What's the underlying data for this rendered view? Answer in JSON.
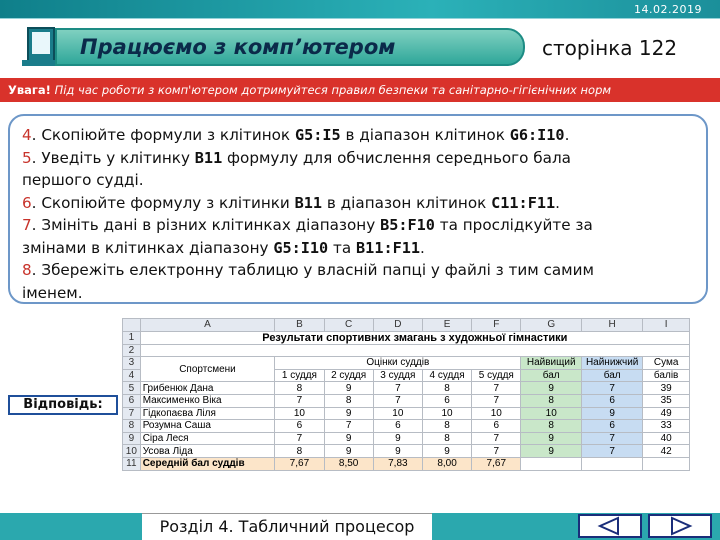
{
  "header": {
    "date": "14.02.2019",
    "title": "Працюємо з комп’ютером",
    "page": "сторінка 122"
  },
  "warning": {
    "label": "Увага!",
    "text": "Під час роботи з комп'ютером дотримуйтеся правил безпеки та санітарно-гігієнічних норм"
  },
  "task": {
    "l1": {
      "n": "4",
      "a": ". Скопіюйте формули з клітинок ",
      "b": "G5:I5",
      "c": " в діапазон клітинок ",
      "d": "G6:I10",
      "e": "."
    },
    "l2": {
      "n": "5",
      "a": ". Уведіть у клітинку ",
      "b": "B11",
      "c": " формулу для обчислення середнього бала"
    },
    "l3": "першого судді.",
    "l4": {
      "n": "6",
      "a": ". Скопіюйте формулу з клітинки ",
      "b": "B11",
      "c": " в діапазон клітинок ",
      "d": "C11:F11",
      "e": "."
    },
    "l5": {
      "n": "7",
      "a": ". Змініть дані в різних клітинках діапазону ",
      "b": "B5:F10",
      "c": " та прослідкуйте за"
    },
    "l6": {
      "a": "змінами в клітинках діапазону ",
      "b": "G5:I10",
      "c": " та ",
      "d": "B11:F11",
      "e": "."
    },
    "l7": {
      "n": "8",
      "a": ". Збережіть електронну таблицю у власній папці у файлі з тим самим"
    },
    "l8": "іменем."
  },
  "answer_label": "Відповідь:",
  "sheet": {
    "cols": [
      "",
      "A",
      "B",
      "C",
      "D",
      "E",
      "F",
      "G",
      "H",
      "I"
    ],
    "title": "Результати спортивних змагань з художньої гімнастики",
    "h_sportsmen": "Спортсмени",
    "h_scores": "Оцінки суддів",
    "h_best1": "Найвищий",
    "h_best2": "бал",
    "h_low1": "Найнижчий",
    "h_low2": "бал",
    "h_sum1": "Сума",
    "h_sum2": "балів",
    "judges": [
      "1 суддя",
      "2 суддя",
      "3 суддя",
      "4 суддя",
      "5 суддя"
    ],
    "rows": [
      {
        "n": "5",
        "name": "Грибенюк Дана",
        "v": [
          "8",
          "9",
          "7",
          "8",
          "7"
        ],
        "g": "9",
        "h": "7",
        "i": "39"
      },
      {
        "n": "6",
        "name": "Максименко Віка",
        "v": [
          "7",
          "8",
          "7",
          "6",
          "7"
        ],
        "g": "8",
        "h": "6",
        "i": "35"
      },
      {
        "n": "7",
        "name": "Гідкопаєва Ліля",
        "v": [
          "10",
          "9",
          "10",
          "10",
          "10"
        ],
        "g": "10",
        "h": "9",
        "i": "49"
      },
      {
        "n": "8",
        "name": "Розумна Саша",
        "v": [
          "6",
          "7",
          "6",
          "8",
          "6"
        ],
        "g": "8",
        "h": "6",
        "i": "33"
      },
      {
        "n": "9",
        "name": "Сіра Леся",
        "v": [
          "7",
          "9",
          "9",
          "8",
          "7"
        ],
        "g": "9",
        "h": "7",
        "i": "40"
      },
      {
        "n": "10",
        "name": "Усова Ліда",
        "v": [
          "8",
          "9",
          "9",
          "9",
          "7"
        ],
        "g": "9",
        "h": "7",
        "i": "42"
      }
    ],
    "avg_label": "Середній бал суддів",
    "avg": [
      "7,67",
      "8,50",
      "7,83",
      "8,00",
      "7,67"
    ]
  },
  "footer": {
    "section": "Розділ 4. Табличний процесор"
  },
  "nav": {
    "prev_icon": "triangle-left-icon",
    "next_icon": "triangle-right-icon"
  }
}
